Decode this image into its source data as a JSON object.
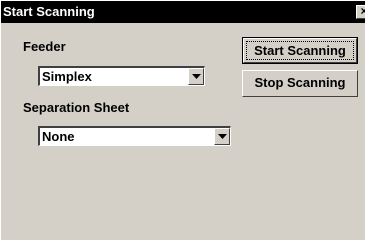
{
  "window": {
    "title": "Start Scanning",
    "close_glyph": "×"
  },
  "feeder": {
    "label": "Feeder",
    "value": "Simplex"
  },
  "separation": {
    "label": "Separation Sheet",
    "value": "None"
  },
  "buttons": {
    "start_label": "Start Scanning",
    "stop_label": "Stop Scanning"
  },
  "icons": {
    "close": "close-icon",
    "dropdown": "chevron-down-icon"
  }
}
